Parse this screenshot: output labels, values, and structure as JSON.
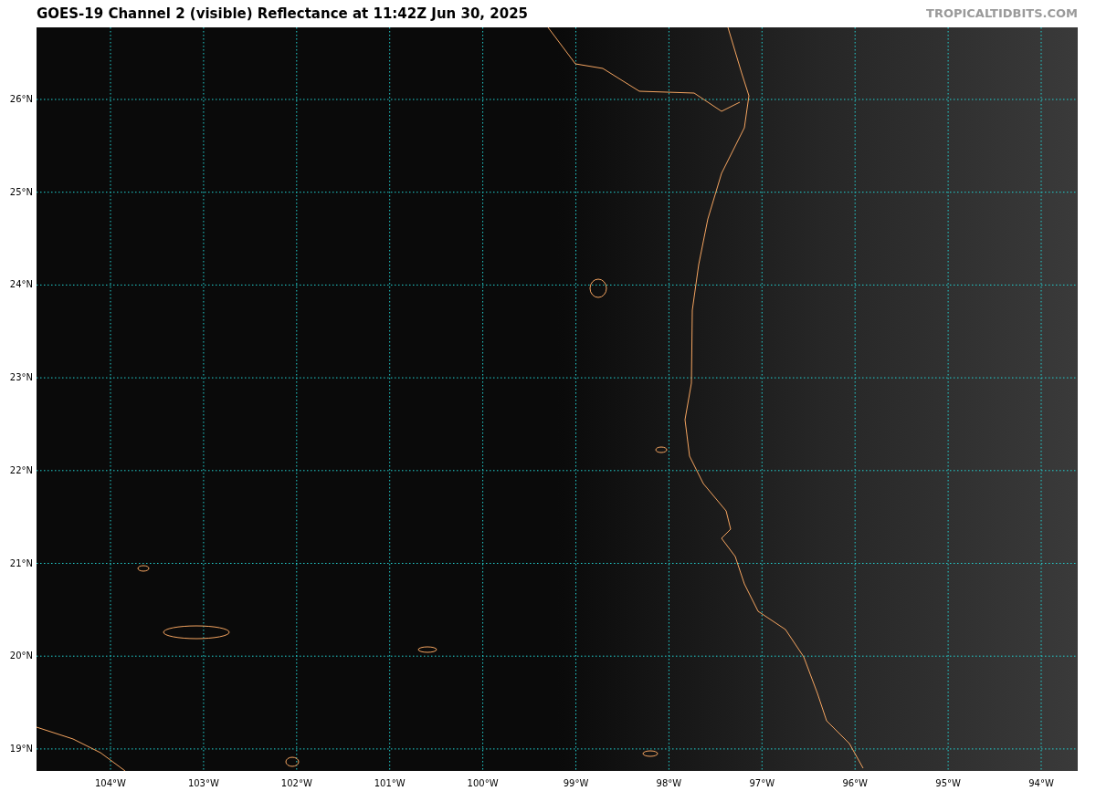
{
  "title": "GOES-19 Channel 2 (visible) Reflectance at 11:42Z Jun 30, 2025",
  "site_label": "TROPICALTIDBITS.COM",
  "map": {
    "latitude_labels": [
      "26°N",
      "25°N",
      "24°N",
      "23°N",
      "22°N",
      "21°N",
      "20°N",
      "19°N"
    ],
    "longitude_labels": [
      "104°W",
      "103°W",
      "102°W",
      "101°W",
      "100°W",
      "99°W",
      "98°W",
      "97°W",
      "96°W",
      "95°W",
      "94°W"
    ]
  }
}
